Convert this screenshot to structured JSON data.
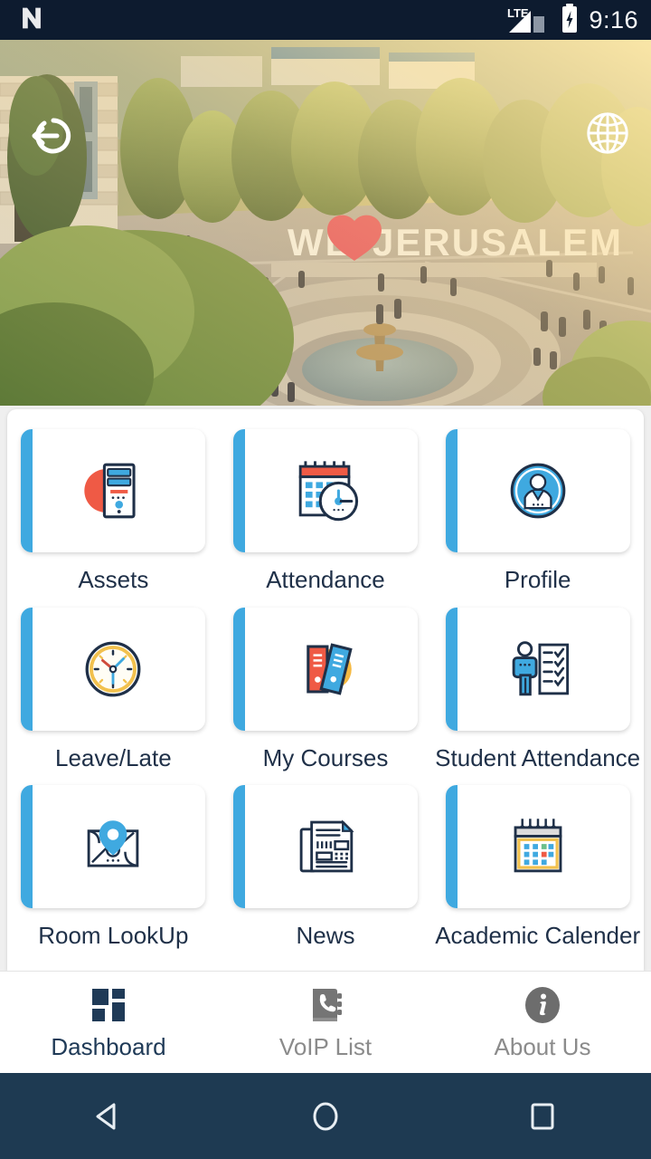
{
  "statusbar": {
    "app_icon": "android-n-logo-icon",
    "network": "LTE",
    "signal_icon": "signal-bars-icon",
    "battery_icon": "battery-charging-icon",
    "time": "9:16"
  },
  "hero": {
    "image_description": "Aerial photo of university campus plaza with circular fountain, stone building, trees and a WE LOVE JERUSALEM sign",
    "sign_text": "WE ♥ JERUSALEM",
    "logout_button": "logout-icon",
    "language_button": "globe-icon"
  },
  "dashboard": {
    "tiles": [
      {
        "label": "Assets",
        "icon": "server-tower-icon"
      },
      {
        "label": "Attendance",
        "icon": "calendar-clock-icon"
      },
      {
        "label": "Profile",
        "icon": "user-avatar-icon"
      },
      {
        "label": "Leave/Late",
        "icon": "clock-icon"
      },
      {
        "label": "My Courses",
        "icon": "books-binders-icon"
      },
      {
        "label": "Student Attendance",
        "icon": "person-checklist-icon"
      },
      {
        "label": "Room LookUp",
        "icon": "map-pin-icon"
      },
      {
        "label": "News",
        "icon": "newspaper-icon"
      },
      {
        "label": "Academic Calender",
        "icon": "spiral-calendar-icon"
      }
    ]
  },
  "bottom_nav": {
    "items": [
      {
        "label": "Dashboard",
        "icon": "dashboard-grid-icon",
        "active": true
      },
      {
        "label": "VoIP List",
        "icon": "phone-book-icon",
        "active": false
      },
      {
        "label": "About Us",
        "icon": "info-circle-icon",
        "active": false
      }
    ]
  },
  "system_nav": {
    "back": "back-triangle-icon",
    "home": "home-circle-icon",
    "recents": "recents-square-icon"
  },
  "colors": {
    "status_bar": "#0d1b2f",
    "accent_blue": "#3fa9e0",
    "text_dark": "#1f3048",
    "nav_inactive": "#8b8b8b",
    "system_nav": "#1e3a52",
    "page_bg": "#efefef"
  }
}
